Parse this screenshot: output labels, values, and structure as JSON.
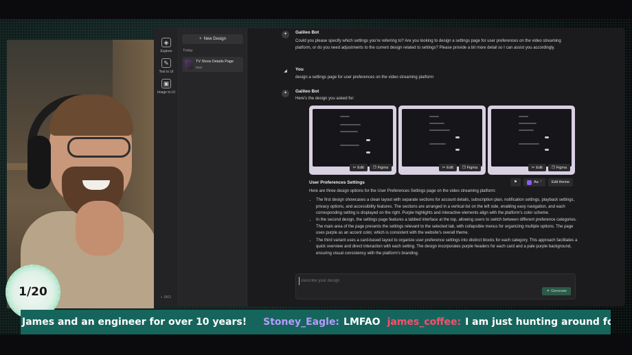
{
  "rail": {
    "items": [
      {
        "label": "Explore",
        "icon": "compass-icon"
      },
      {
        "label": "Text to UI",
        "icon": "pencil-square-icon"
      },
      {
        "label": "Image to UI",
        "icon": "image-icon"
      }
    ],
    "bottom_label": "SKO"
  },
  "sidebar": {
    "new_design_label": "New Design",
    "section_label": "Today",
    "history": [
      {
        "title": "TV Show Details Page",
        "subtitle": "Web"
      }
    ]
  },
  "chat": {
    "messages": [
      {
        "author": "Galileo Bot",
        "text": "Could you please specify which settings you're referring to? Are you looking to design a settings page for user preferences on the video streaming platform, or do you need adjustments to the current design related to settings? Please provide a bit more detail so I can assist you accordingly."
      },
      {
        "author": "You",
        "text": "design a settings page for user preferences on the video streaming platform"
      },
      {
        "author": "Galileo Bot",
        "text": "Here's the design you asked for:"
      }
    ],
    "thumbnail_actions": {
      "edit": "Edit",
      "figma": "Figma"
    },
    "design_count": 3,
    "result_title": "User Preferences Settings",
    "tools": {
      "font_label": "Aa",
      "edit_theme_label": "Edit theme",
      "accent_color": "#8b5cf6"
    },
    "intro": "Here are three design options for the User Preferences Settings page on the video streaming platform:",
    "bullets": [
      "The first design showcases a clean layout with separate sections for account details, subscription plan, notification settings, playback settings, privacy options, and accessibility features. The sections are arranged in a vertical list on the left side, enabling easy navigation, and each corresponding setting is displayed on the right. Purple highlights and interactive elements align with the platform's color scheme.",
      "In the second design, the settings page features a tabbed interface at the top, allowing users to switch between different preference categories. The main area of the page presents the settings relevant to the selected tab, with collapsible menus for organizing multiple options. The page uses purple as an accent color, which is consistent with the website's overall theme.",
      "The third variant uses a card-based layout to organize user preference settings into distinct blocks for each category. This approach facilitates a quick overview and direct interaction with each setting. The design incorporates purple headers for each card and a pale purple background, ensuring visual consistency with the platform's branding."
    ],
    "composer": {
      "placeholder": "Describe your design",
      "generate_label": "Generate"
    }
  },
  "badge": {
    "text": "1/20"
  },
  "ticker": {
    "lead_text": "James and an engineer for over 10 years!",
    "user1": "Stoney_Eagle:",
    "msg1": "LMFAO",
    "user2": "james_coffee:",
    "msg2": "I am just hunting around for cool dev channels haha",
    "colors": {
      "bg": "#16655c",
      "user1": "#b69cff",
      "user2": "#ff4d6d"
    }
  }
}
